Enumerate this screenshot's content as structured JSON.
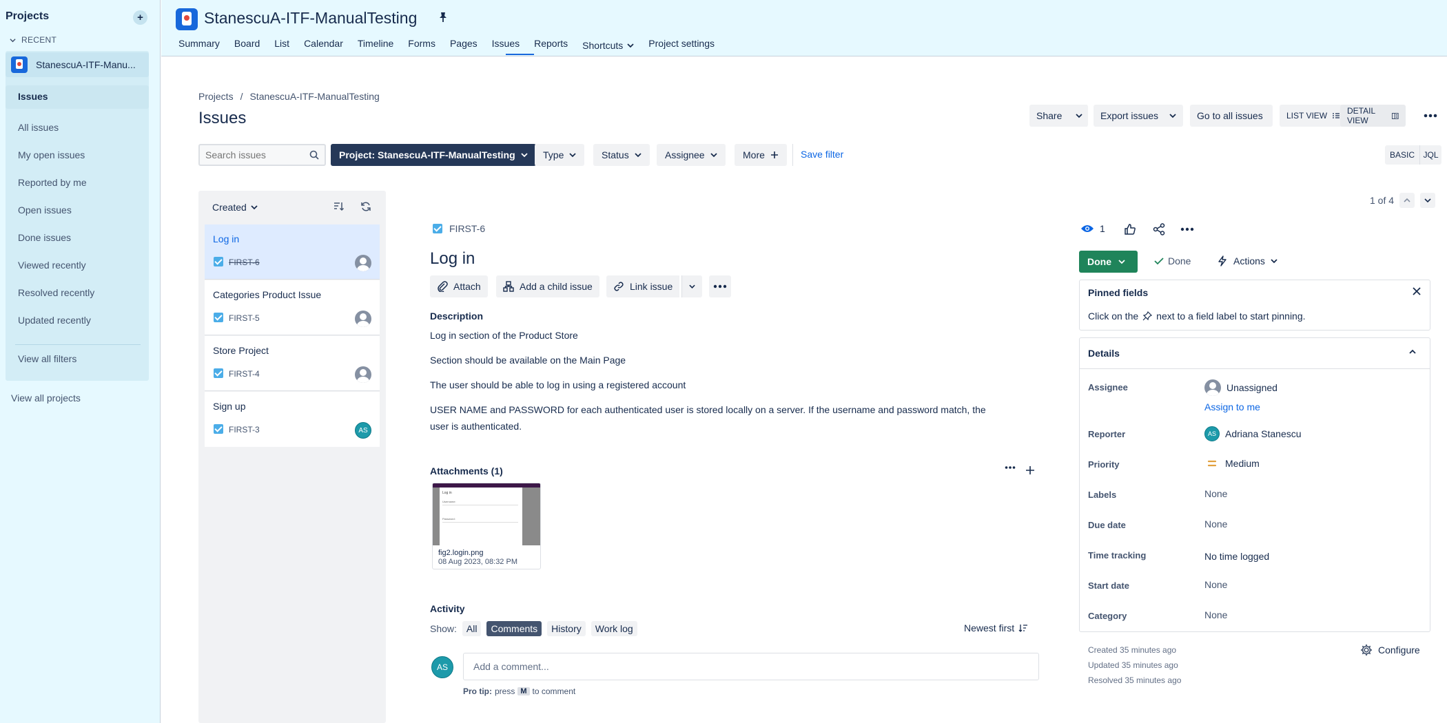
{
  "sidebar": {
    "title": "Projects",
    "add_label": "+",
    "recent_label": "RECENT",
    "project_name": "StanescuA-ITF-Manu...",
    "items": [
      {
        "label": "Issues"
      },
      {
        "label": "All issues"
      },
      {
        "label": "My open issues"
      },
      {
        "label": "Reported by me"
      },
      {
        "label": "Open issues"
      },
      {
        "label": "Done issues"
      },
      {
        "label": "Viewed recently"
      },
      {
        "label": "Resolved recently"
      },
      {
        "label": "Updated recently"
      },
      {
        "label": "View all filters"
      }
    ],
    "view_all_projects": "View all projects"
  },
  "header": {
    "project_title": "StanescuA-ITF-ManualTesting",
    "tabs": [
      {
        "label": "Summary"
      },
      {
        "label": "Board"
      },
      {
        "label": "List"
      },
      {
        "label": "Calendar"
      },
      {
        "label": "Timeline"
      },
      {
        "label": "Forms"
      },
      {
        "label": "Pages"
      },
      {
        "label": "Issues"
      },
      {
        "label": "Reports"
      },
      {
        "label": "Shortcuts"
      },
      {
        "label": "Project settings"
      }
    ],
    "active_tab": "Issues"
  },
  "breadcrumb": {
    "root": "Projects",
    "sep": "/",
    "project": "StanescuA-ITF-ManualTesting"
  },
  "page_title": "Issues",
  "toolbar": {
    "share": "Share",
    "export": "Export issues",
    "goto": "Go to all issues",
    "list_view": "LIST VIEW",
    "detail_view": "DETAIL VIEW"
  },
  "filters": {
    "search_placeholder": "Search issues",
    "project": "Project: StanescuA-ITF-ManualTesting",
    "type": "Type",
    "status": "Status",
    "assignee": "Assignee",
    "more": "More",
    "save_filter": "Save filter",
    "basic": "BASIC",
    "jql": "JQL"
  },
  "list": {
    "sort_label": "Created",
    "issues": [
      {
        "title": "Log in",
        "key": "FIRST-6",
        "assignee": "none"
      },
      {
        "title": "Categories Product Issue",
        "key": "FIRST-5",
        "assignee": "none"
      },
      {
        "title": "Store Project",
        "key": "FIRST-4",
        "assignee": "none"
      },
      {
        "title": "Sign up",
        "key": "FIRST-3",
        "assignee": "AS"
      }
    ]
  },
  "pagination": {
    "text": "1 of 4"
  },
  "issue": {
    "key": "FIRST-6",
    "title": "Log in",
    "actions": {
      "attach": "Attach",
      "child": "Add a child issue",
      "link": "Link issue"
    },
    "description_label": "Description",
    "description": [
      "Log in section of the Product Store",
      "Section should be available on the Main Page",
      "The user should be able to log in using a registered account",
      "USER NAME and PASSWORD for each authenticated user is stored locally on a server. If the username and password  match, the user is authenticated."
    ],
    "attachments_label": "Attachments (1)",
    "attachment": {
      "name": "fig2.login.png",
      "date": "08 Aug 2023, 08:32 PM",
      "preview_title": "Log in",
      "preview_field1": "Username:",
      "preview_field2": "Password:"
    },
    "activity": {
      "label": "Activity",
      "show": "Show:",
      "filters": [
        "All",
        "Comments",
        "History",
        "Work log"
      ],
      "active": "Comments",
      "sort": "Newest first",
      "avatar": "AS",
      "comment_placeholder": "Add a comment...",
      "protip_label": "Pro tip:",
      "protip_press": "press",
      "protip_key": "M",
      "protip_end": "to comment"
    }
  },
  "right": {
    "watchers": "1",
    "status_button": "Done",
    "status_text": "Done",
    "actions": "Actions",
    "pinned": {
      "title": "Pinned fields",
      "hint_before": "Click on the",
      "hint_after": "next to a field label to start pinning."
    },
    "details": {
      "title": "Details",
      "fields": [
        {
          "label": "Assignee",
          "value": "Unassigned"
        },
        {
          "label": "Reporter",
          "value": "Adriana Stanescu"
        },
        {
          "label": "Priority",
          "value": "Medium"
        },
        {
          "label": "Labels",
          "value": "None"
        },
        {
          "label": "Due date",
          "value": "None"
        },
        {
          "label": "Time tracking",
          "value": "No time logged"
        },
        {
          "label": "Start date",
          "value": "None"
        },
        {
          "label": "Category",
          "value": "None"
        }
      ],
      "assign_to_me": "Assign to me",
      "reporter_initials": "AS"
    },
    "meta": {
      "created": "Created 35 minutes ago",
      "updated": "Updated 35 minutes ago",
      "resolved": "Resolved 35 minutes ago"
    },
    "configure": "Configure"
  },
  "colors": {
    "accent": "#1868db",
    "done": "#1f845a",
    "dark_button": "#253858",
    "sidebar_bg": "#e6f9ff"
  }
}
